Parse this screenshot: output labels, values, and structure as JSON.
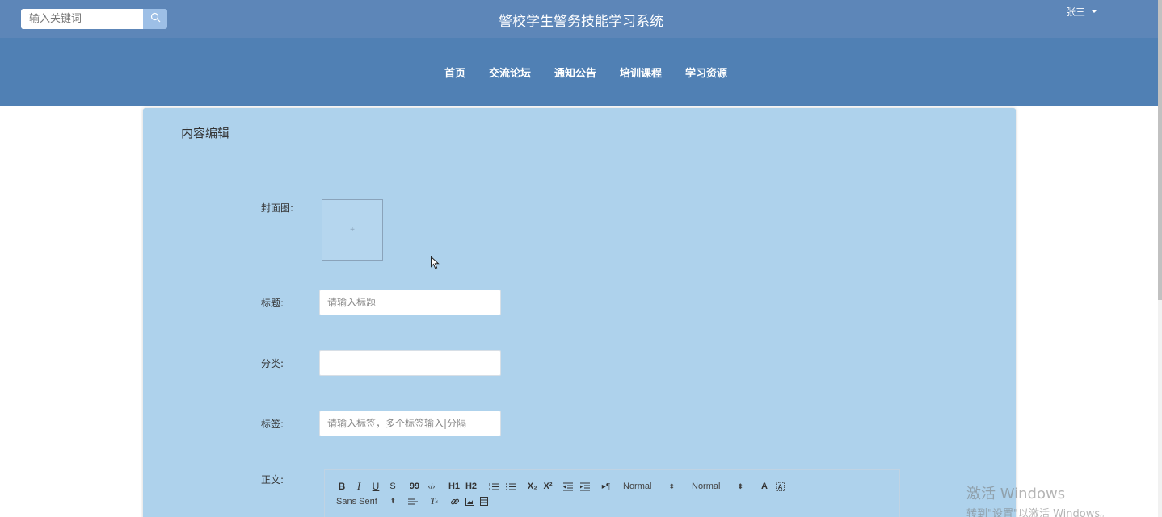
{
  "header": {
    "search_placeholder": "输入关键词",
    "site_title": "警校学生警务技能学习系统",
    "user_name": "张三"
  },
  "nav": {
    "items": [
      {
        "label": "首页"
      },
      {
        "label": "交流论坛"
      },
      {
        "label": "通知公告"
      },
      {
        "label": "培训课程"
      },
      {
        "label": "学习资源"
      }
    ]
  },
  "form": {
    "card_title": "内容编辑",
    "cover_label": "封面图:",
    "cover_plus": "+",
    "title_label": "标题:",
    "title_placeholder": "请输入标题",
    "category_label": "分类:",
    "category_value": "",
    "tags_label": "标签:",
    "tags_placeholder": "请输入标签，多个标签输入|分隔",
    "body_label": "正文:"
  },
  "editor_toolbar": {
    "bold": "B",
    "italic": "I",
    "underline": "U",
    "strike": "S",
    "blockquote": "99",
    "code": "‹/›",
    "h1": "H1",
    "h2": "H2",
    "subscript": "X₂",
    "superscript": "X²",
    "size_select": "Normal",
    "header_select": "Normal",
    "font_select": "Sans Serif"
  },
  "watermark": {
    "line1": "激活 Windows",
    "line2": "转到\"设置\"以激活 Windows。"
  },
  "colors": {
    "topbar": "#5d86b8",
    "navbar": "#5080b4",
    "card": "#aed2ec"
  }
}
